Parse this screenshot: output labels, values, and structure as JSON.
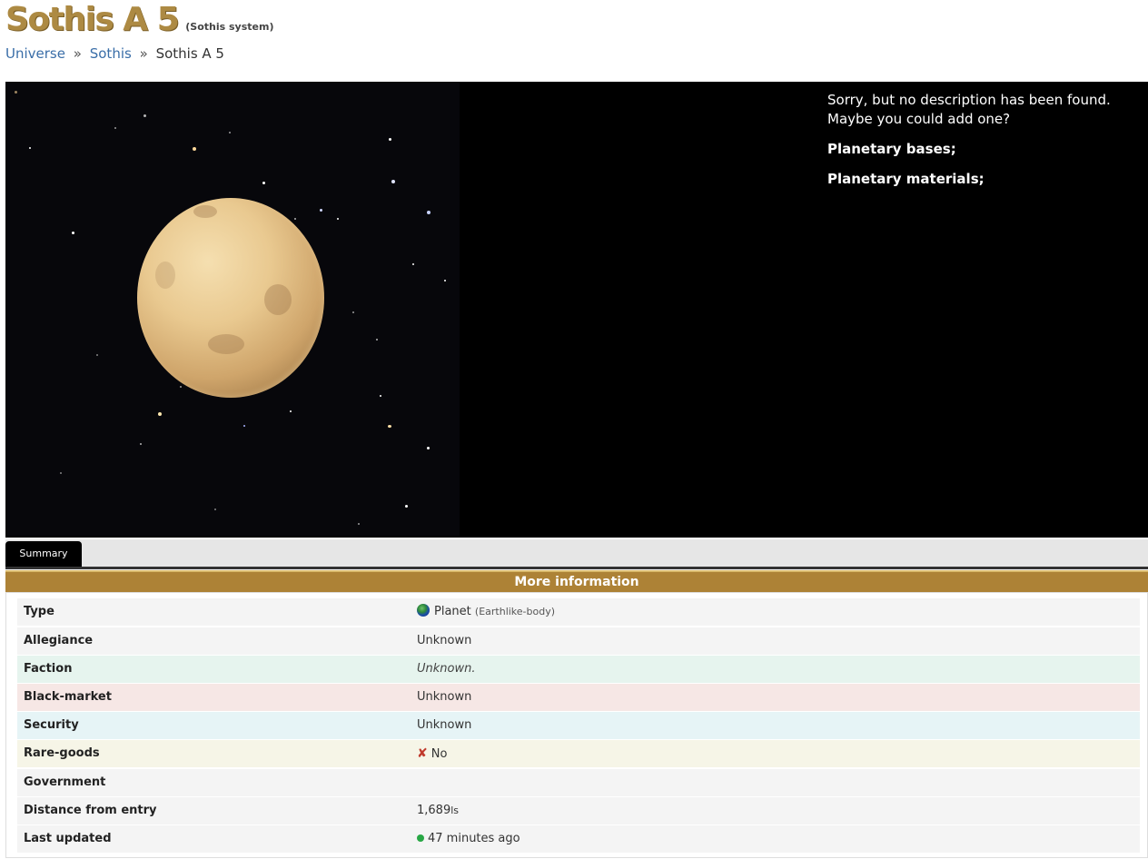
{
  "header": {
    "title": "Sothis A 5",
    "subtitle": "(Sothis system)"
  },
  "breadcrumb": {
    "items": [
      "Universe",
      "Sothis"
    ],
    "current": "Sothis A 5",
    "separator": "»"
  },
  "description": {
    "text": "Sorry, but no description has been found. Maybe you could add one?",
    "bases_label": "Planetary bases;",
    "materials_label": "Planetary materials;"
  },
  "tabs": [
    {
      "label": "Summary",
      "active": true
    }
  ],
  "more_info": {
    "header": "More information",
    "rows": [
      {
        "key": "Type",
        "value": "Planet",
        "detail": "(Earthlike-body)",
        "icon": "globe-icon",
        "bg": "#f4f4f4"
      },
      {
        "key": "Allegiance",
        "value": "Unknown",
        "bg": "#f4f4f4"
      },
      {
        "key": "Faction",
        "value": "Unknown.",
        "bg": "#e6f4ee"
      },
      {
        "key": "Black-market",
        "value": "Unknown",
        "bg": "#f6e7e5"
      },
      {
        "key": "Security",
        "value": "Unknown",
        "bg": "#e6f4f6"
      },
      {
        "key": "Rare-goods",
        "value": "No",
        "icon": "cross-icon",
        "bg": "#f6f5e7"
      },
      {
        "key": "Government",
        "value": "",
        "bg": "#f4f4f4"
      },
      {
        "key": "Distance from entry",
        "value": "1,689",
        "unit": "ls",
        "bg": "#f4f4f4"
      },
      {
        "key": "Last updated",
        "value": "47 minutes ago",
        "icon": "status-dot-icon",
        "bg": "#f4f4f4"
      }
    ]
  },
  "colors": {
    "title": "#ad8a43",
    "link": "#3a6ea8",
    "info_header": "#ad8236",
    "status_ok": "#28a745",
    "cross": "#c0392b"
  }
}
